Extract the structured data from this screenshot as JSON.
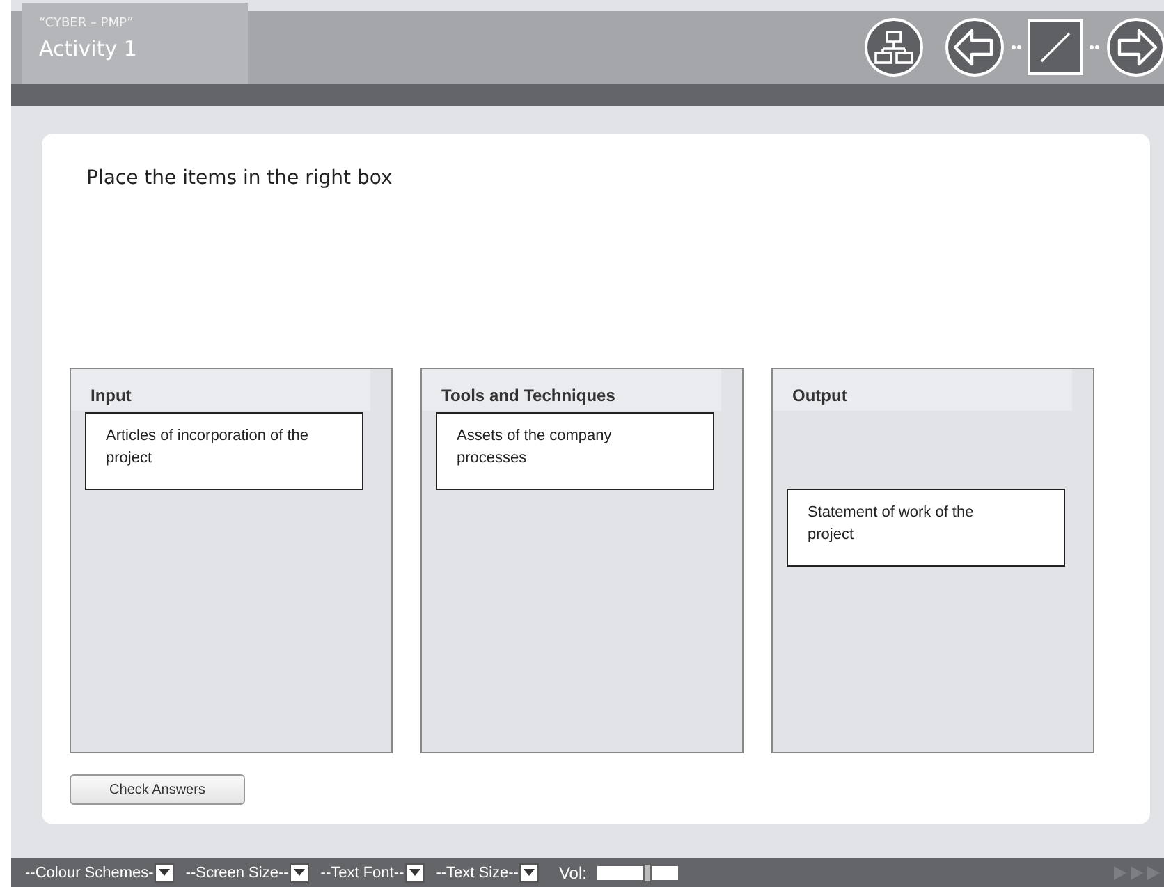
{
  "header": {
    "course": "“CYBER – PMP”",
    "title": "Activity 1"
  },
  "instruction": "Place the items in the right box",
  "columns": [
    {
      "title": "Input",
      "items": [
        "Articles of incorporation of the project"
      ]
    },
    {
      "title": "Tools and Techniques",
      "items": [
        "Assets of the company processes"
      ]
    },
    {
      "title": "Output",
      "items": [
        "Statement of work of the project"
      ]
    }
  ],
  "check_button": "Check Answers",
  "toolbar": {
    "dropdowns": [
      "--Colour Schemes-",
      "--Screen Size--",
      "--Text Font--",
      "--Text Size--"
    ],
    "volume_label": "Vol:",
    "volume": {
      "level": 0.62
    }
  }
}
